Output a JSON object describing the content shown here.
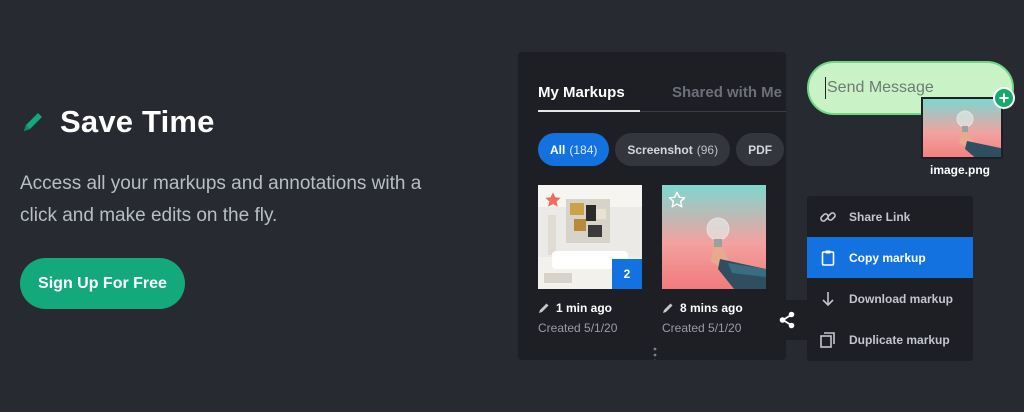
{
  "hero": {
    "title": "Save Time",
    "description": "Access all your markups and annotations with a click and make edits on the fly.",
    "cta_label": "Sign Up For Free",
    "accent_color": "#13a97a"
  },
  "panel": {
    "tabs": [
      {
        "label": "My Markups",
        "active": true
      },
      {
        "label": "Shared with Me",
        "active": false
      }
    ],
    "filters": [
      {
        "label": "All",
        "count": "(184)",
        "active": true
      },
      {
        "label": "Screenshot",
        "count": "(96)",
        "active": false
      },
      {
        "label": "PDF",
        "count": "",
        "active": false
      }
    ],
    "cards": [
      {
        "time": "1 min ago",
        "created": "Created 5/1/20",
        "badge": "2",
        "starred": true
      },
      {
        "time": "8 mins ago",
        "created": "Created 5/1/20",
        "starred": false
      }
    ]
  },
  "menu": {
    "items": [
      {
        "label": "Share Link",
        "icon": "link-icon"
      },
      {
        "label": "Copy markup",
        "icon": "clipboard-icon",
        "active": true
      },
      {
        "label": "Download markup",
        "icon": "download-icon"
      },
      {
        "label": "Duplicate markup",
        "icon": "duplicate-icon"
      }
    ]
  },
  "message": {
    "placeholder": "Send Message",
    "attachment_name": "image.png"
  },
  "colors": {
    "background": "#272a31",
    "panel": "#1d1f24",
    "primary_blue": "#1372e0",
    "bubble_green": "#c9f3c7"
  }
}
